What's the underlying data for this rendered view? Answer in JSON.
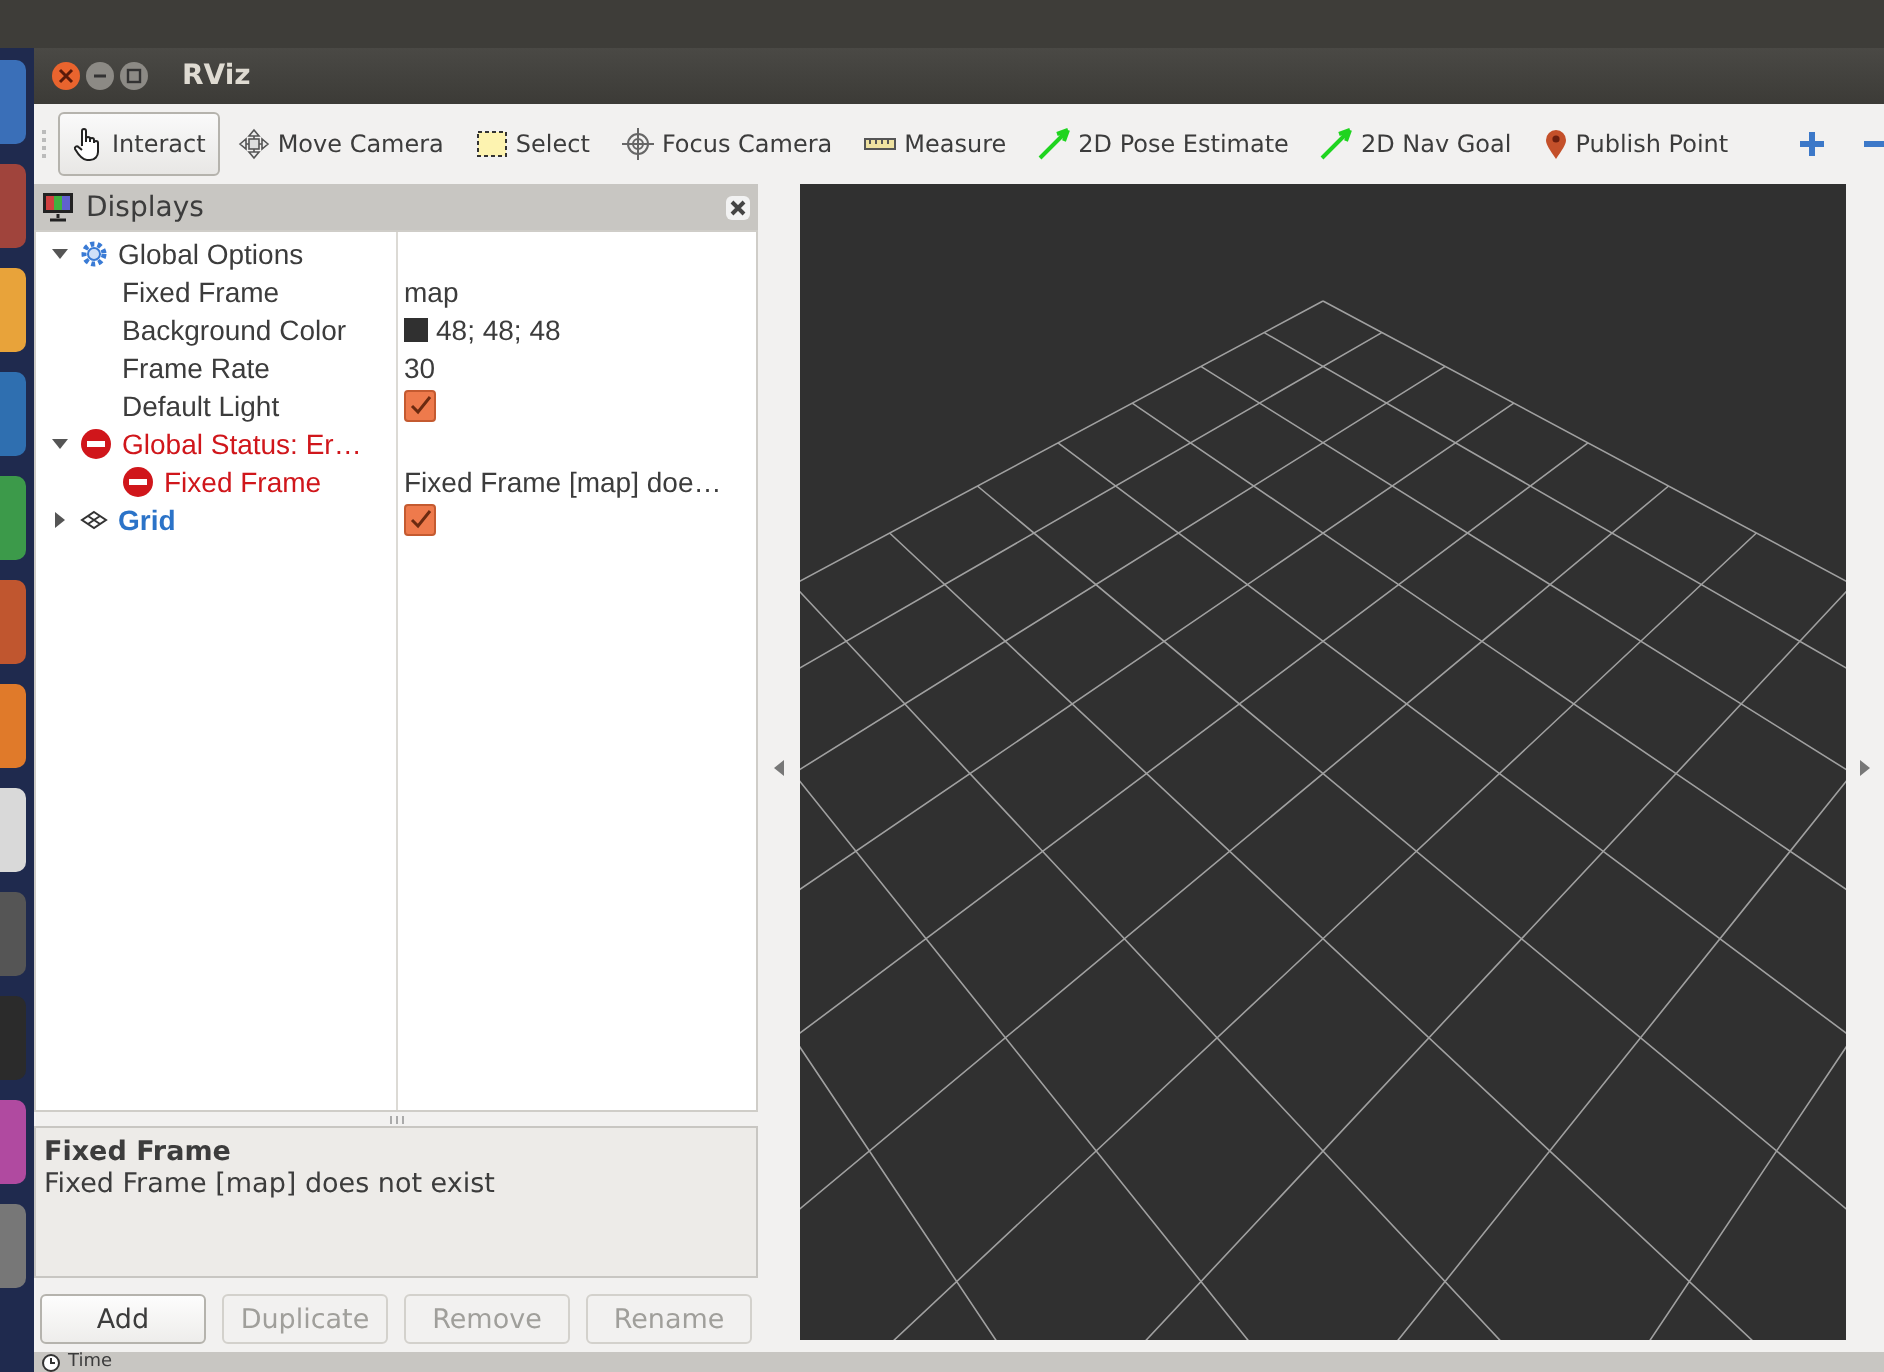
{
  "window": {
    "title": "RViz"
  },
  "toolbar": {
    "tools": [
      {
        "kind": "interact",
        "label": "Interact",
        "selected": true
      },
      {
        "kind": "move",
        "label": "Move Camera",
        "selected": false
      },
      {
        "kind": "select",
        "label": "Select",
        "selected": false
      },
      {
        "kind": "focus",
        "label": "Focus Camera",
        "selected": false
      },
      {
        "kind": "measure",
        "label": "Measure",
        "selected": false
      },
      {
        "kind": "pose",
        "label": "2D Pose Estimate",
        "selected": false
      },
      {
        "kind": "goal",
        "label": "2D Nav Goal",
        "selected": false
      },
      {
        "kind": "point",
        "label": "Publish Point",
        "selected": false
      }
    ]
  },
  "displays": {
    "title": "Displays",
    "items": [
      {
        "kind": "options",
        "label": "Global Options",
        "error": false,
        "expanded": true,
        "children": [
          {
            "kind": "text",
            "label": "Fixed Frame",
            "value": "map"
          },
          {
            "kind": "color",
            "label": "Background Color",
            "value": "48; 48; 48",
            "color": "#303030"
          },
          {
            "kind": "text",
            "label": "Frame Rate",
            "value": "30"
          },
          {
            "kind": "checkbox",
            "label": "Default Light",
            "checked": true
          }
        ]
      },
      {
        "kind": "status",
        "label": "Global Status: Er…",
        "error": true,
        "expanded": true,
        "children": [
          {
            "kind": "text",
            "label": "Fixed Frame",
            "error": true,
            "value": "Fixed Frame [map] doe…"
          }
        ]
      },
      {
        "kind": "grid",
        "label": "Grid",
        "error": false,
        "expanded": false,
        "checked": true
      }
    ]
  },
  "description": {
    "title": "Fixed Frame",
    "text": "Fixed Frame [map] does not exist"
  },
  "buttons": [
    {
      "label": "Add",
      "disabled": false
    },
    {
      "label": "Duplicate",
      "disabled": true
    },
    {
      "label": "Remove",
      "disabled": true
    },
    {
      "label": "Rename",
      "disabled": true
    }
  ],
  "time_panel": {
    "title": "Time"
  }
}
